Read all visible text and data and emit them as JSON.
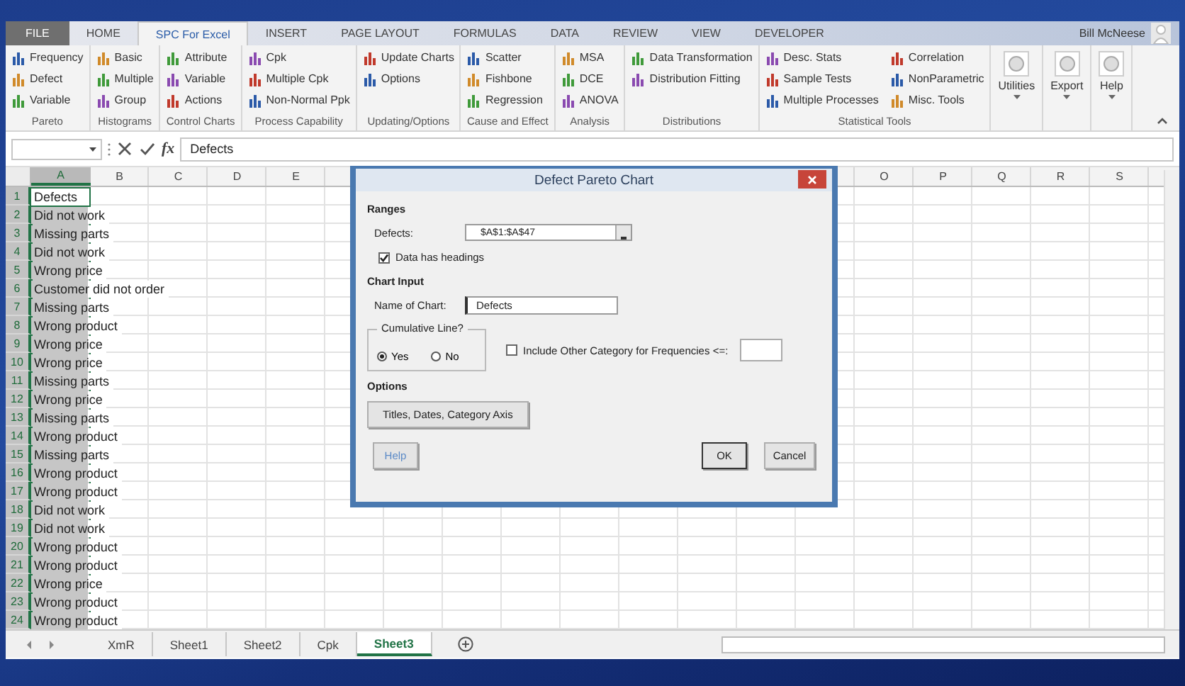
{
  "ribbon_tabs": [
    {
      "label": "FILE",
      "kind": "file",
      "selected": false
    },
    {
      "label": "HOME",
      "kind": "tab",
      "selected": false
    },
    {
      "label": "SPC For Excel",
      "kind": "tab",
      "selected": true
    },
    {
      "label": "INSERT",
      "kind": "tab",
      "selected": false
    },
    {
      "label": "PAGE LAYOUT",
      "kind": "tab",
      "selected": false
    },
    {
      "label": "FORMULAS",
      "kind": "tab",
      "selected": false
    },
    {
      "label": "DATA",
      "kind": "tab",
      "selected": false
    },
    {
      "label": "REVIEW",
      "kind": "tab",
      "selected": false
    },
    {
      "label": "VIEW",
      "kind": "tab",
      "selected": false
    },
    {
      "label": "DEVELOPER",
      "kind": "tab",
      "selected": false
    }
  ],
  "user": {
    "name": "Bill McNeese"
  },
  "ribbon_groups": [
    {
      "label": "Pareto",
      "columns": [
        [
          "Frequency",
          "Defect",
          "Variable"
        ]
      ]
    },
    {
      "label": "Histograms",
      "columns": [
        [
          "Basic",
          "Multiple",
          "Group"
        ]
      ]
    },
    {
      "label": "Control Charts",
      "columns": [
        [
          "Attribute",
          "Variable",
          "Actions"
        ]
      ]
    },
    {
      "label": "Process Capability",
      "columns": [
        [
          "Cpk",
          "Multiple Cpk",
          "Non-Normal Ppk"
        ]
      ]
    },
    {
      "label": "Updating/Options",
      "columns": [
        [
          "Update Charts",
          "Options"
        ]
      ]
    },
    {
      "label": "Cause and Effect",
      "columns": [
        [
          "Scatter",
          "Fishbone",
          "Regression"
        ]
      ]
    },
    {
      "label": "Analysis",
      "columns": [
        [
          "MSA",
          "DCE",
          "ANOVA"
        ]
      ]
    },
    {
      "label": "Distributions",
      "columns": [
        [
          "Data Transformation",
          "Distribution Fitting"
        ]
      ]
    },
    {
      "label": "Statistical Tools",
      "columns": [
        [
          "Desc. Stats",
          "Sample Tests",
          "Multiple Processes"
        ],
        [
          "Correlation",
          "NonParametric",
          "Misc. Tools"
        ]
      ]
    }
  ],
  "ribbon_buttons": [
    "Utilities",
    "Export",
    "Help"
  ],
  "formula_bar": {
    "function_label": "fx",
    "value": "Defects"
  },
  "columns": [
    {
      "label": "A",
      "selected": true
    },
    {
      "label": "B",
      "selected": false
    },
    {
      "label": "C",
      "selected": false
    },
    {
      "label": "D",
      "selected": false
    },
    {
      "label": "E",
      "selected": false
    }
  ],
  "columns_right": [
    {
      "label": "O",
      "selected": false
    },
    {
      "label": "P",
      "selected": false
    },
    {
      "label": "Q",
      "selected": false
    },
    {
      "label": "R",
      "selected": false
    },
    {
      "label": "S",
      "selected": false
    }
  ],
  "rows": [
    {
      "num": "1",
      "a": "Defects",
      "active": true
    },
    {
      "num": "2",
      "a": "Did not work",
      "active": false
    },
    {
      "num": "3",
      "a": "Missing parts",
      "active": false
    },
    {
      "num": "4",
      "a": "Did not work",
      "active": false
    },
    {
      "num": "5",
      "a": "Wrong price",
      "active": false
    },
    {
      "num": "6",
      "a": "Customer did not order",
      "active": false
    },
    {
      "num": "7",
      "a": "Missing parts",
      "active": false
    },
    {
      "num": "8",
      "a": "Wrong product",
      "active": false
    },
    {
      "num": "9",
      "a": "Wrong price",
      "active": false
    },
    {
      "num": "10",
      "a": "Wrong price",
      "active": false
    },
    {
      "num": "11",
      "a": "Missing parts",
      "active": false
    },
    {
      "num": "12",
      "a": "Wrong price",
      "active": false
    },
    {
      "num": "13",
      "a": "Missing parts",
      "active": false
    },
    {
      "num": "14",
      "a": "Wrong product",
      "active": false
    },
    {
      "num": "15",
      "a": "Missing parts",
      "active": false
    },
    {
      "num": "16",
      "a": "Wrong product",
      "active": false
    },
    {
      "num": "17",
      "a": "Wrong product",
      "active": false
    },
    {
      "num": "18",
      "a": "Did not work",
      "active": false
    },
    {
      "num": "19",
      "a": "Did not work",
      "active": false
    },
    {
      "num": "20",
      "a": "Wrong product",
      "active": false
    },
    {
      "num": "21",
      "a": "Wrong product",
      "active": false
    },
    {
      "num": "22",
      "a": "Wrong price",
      "active": false
    },
    {
      "num": "23",
      "a": "Wrong product",
      "active": false
    },
    {
      "num": "24",
      "a": "Wrong product",
      "active": false
    }
  ],
  "sheet_tabs": [
    {
      "label": "XmR",
      "selected": false
    },
    {
      "label": "Sheet1",
      "selected": false
    },
    {
      "label": "Sheet2",
      "selected": false
    },
    {
      "label": "Cpk",
      "selected": false
    },
    {
      "label": "Sheet3",
      "selected": true
    }
  ],
  "dialog": {
    "title": "Defect Pareto Chart",
    "ranges_heading": "Ranges",
    "defects_label": "Defects:",
    "defects_value": "$A$1:$A$47",
    "headings_checkbox": {
      "label": "Data has headings",
      "checked": true
    },
    "chart_input_heading": "Chart Input",
    "name_label": "Name of Chart:",
    "name_value": "Defects",
    "cumulative_legend": "Cumulative Line?",
    "cumulative_options": [
      {
        "label": "Yes",
        "selected": true
      },
      {
        "label": "No",
        "selected": false
      }
    ],
    "other_checkbox": {
      "label": "Include Other Category for Frequencies <=:",
      "checked": false
    },
    "options_heading": "Options",
    "titles_button": "Titles, Dates, Category Axis",
    "help_button": "Help",
    "ok_button": "OK",
    "cancel_button": "Cancel"
  }
}
